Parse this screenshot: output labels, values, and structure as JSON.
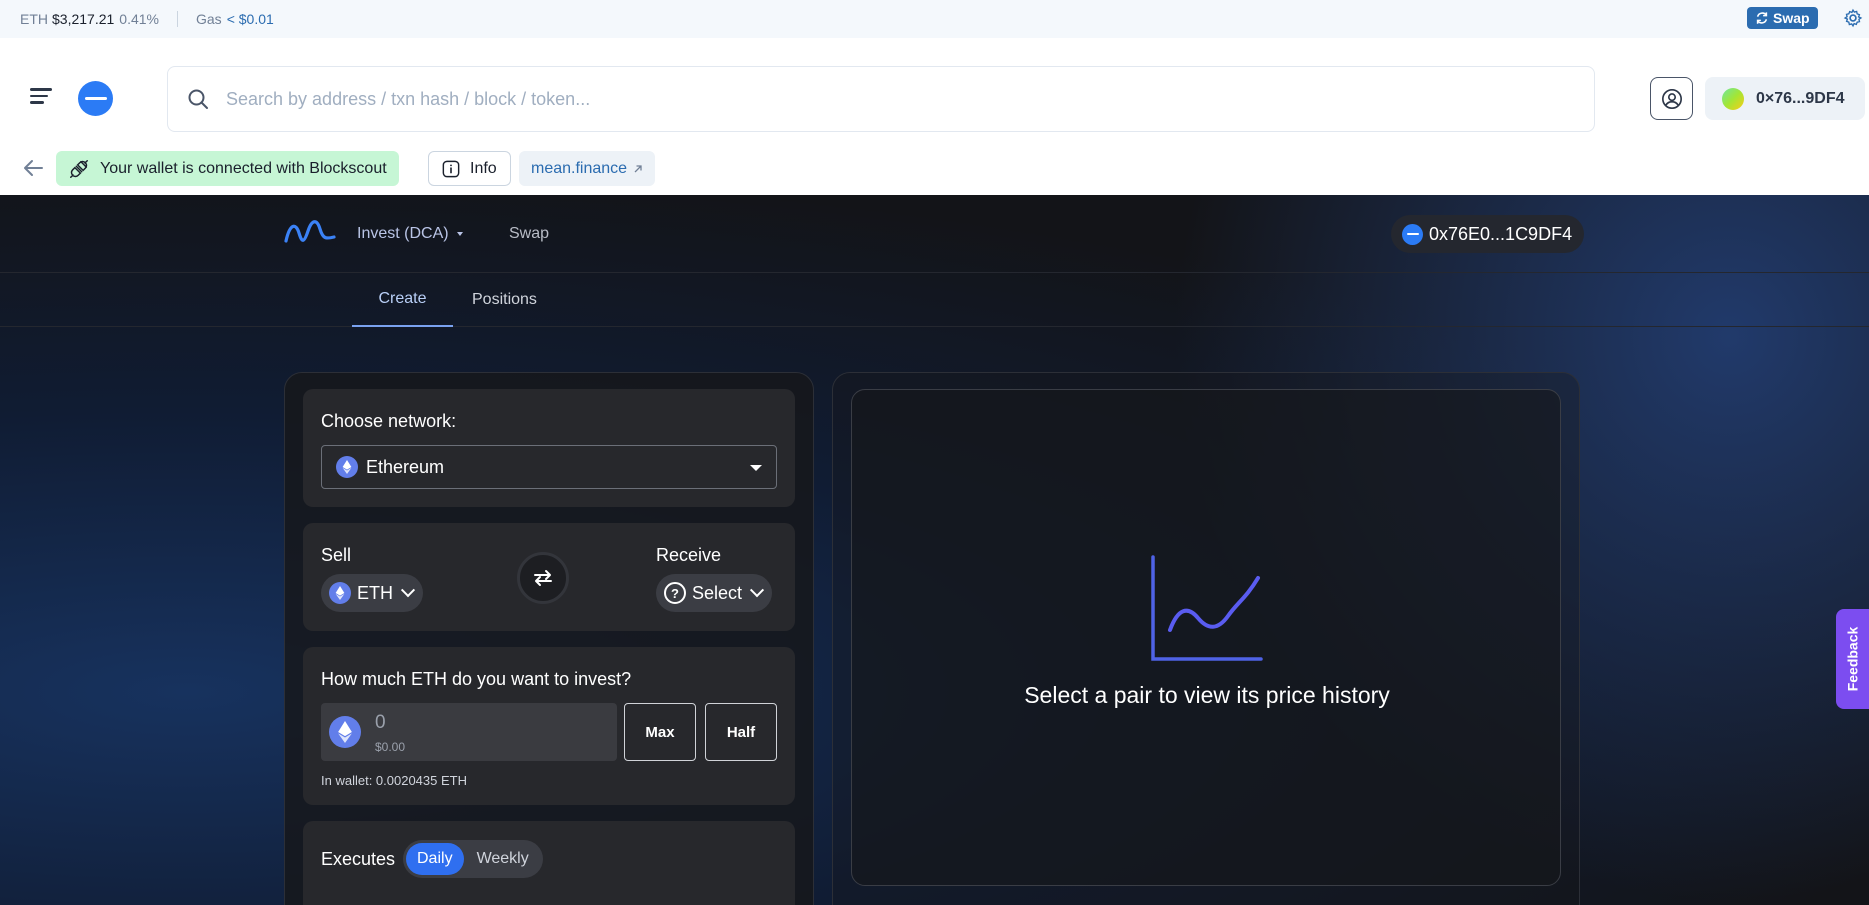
{
  "ticker": {
    "eth_label": "ETH",
    "eth_price": "$3,217.21",
    "eth_change": "0.41%",
    "gas_label": "Gas",
    "gas_value": "< $0.01",
    "swap_label": "Swap"
  },
  "header": {
    "search_placeholder": "Search by address / txn hash / block / token...",
    "wallet_address": "0×76...9DF4"
  },
  "subheader": {
    "connected_text": "Your wallet is connected with Blockscout",
    "info_label": "Info",
    "link_label": "mean.finance"
  },
  "app": {
    "nav": {
      "invest_label": "Invest (DCA)",
      "swap_label": "Swap",
      "wallet": "0x76E0...1C9DF4"
    },
    "tabs": [
      {
        "label": "Create",
        "active": true
      },
      {
        "label": "Positions",
        "active": false
      }
    ],
    "form": {
      "network_label": "Choose network:",
      "network_value": "Ethereum",
      "sell_label": "Sell",
      "receive_label": "Receive",
      "sell_token": "ETH",
      "receive_token": "Select",
      "amount_question": "How much ETH do you want to invest?",
      "amount_value": "0",
      "amount_usd": "$0.00",
      "max_label": "Max",
      "half_label": "Half",
      "wallet_balance": "In wallet: 0.0020435 ETH",
      "executes_label": "Executes",
      "frequency_options": [
        {
          "label": "Daily",
          "active": true
        },
        {
          "label": "Weekly",
          "active": false
        }
      ]
    },
    "chart": {
      "empty_message": "Select a pair to view its price history"
    }
  },
  "feedback": {
    "label": "Feedback"
  },
  "colors": {
    "accent": "#2f6ff0",
    "brand_blue": "#2b7bf5",
    "connected_bg": "#c6f6d5",
    "feedback": "#7c4df0"
  }
}
